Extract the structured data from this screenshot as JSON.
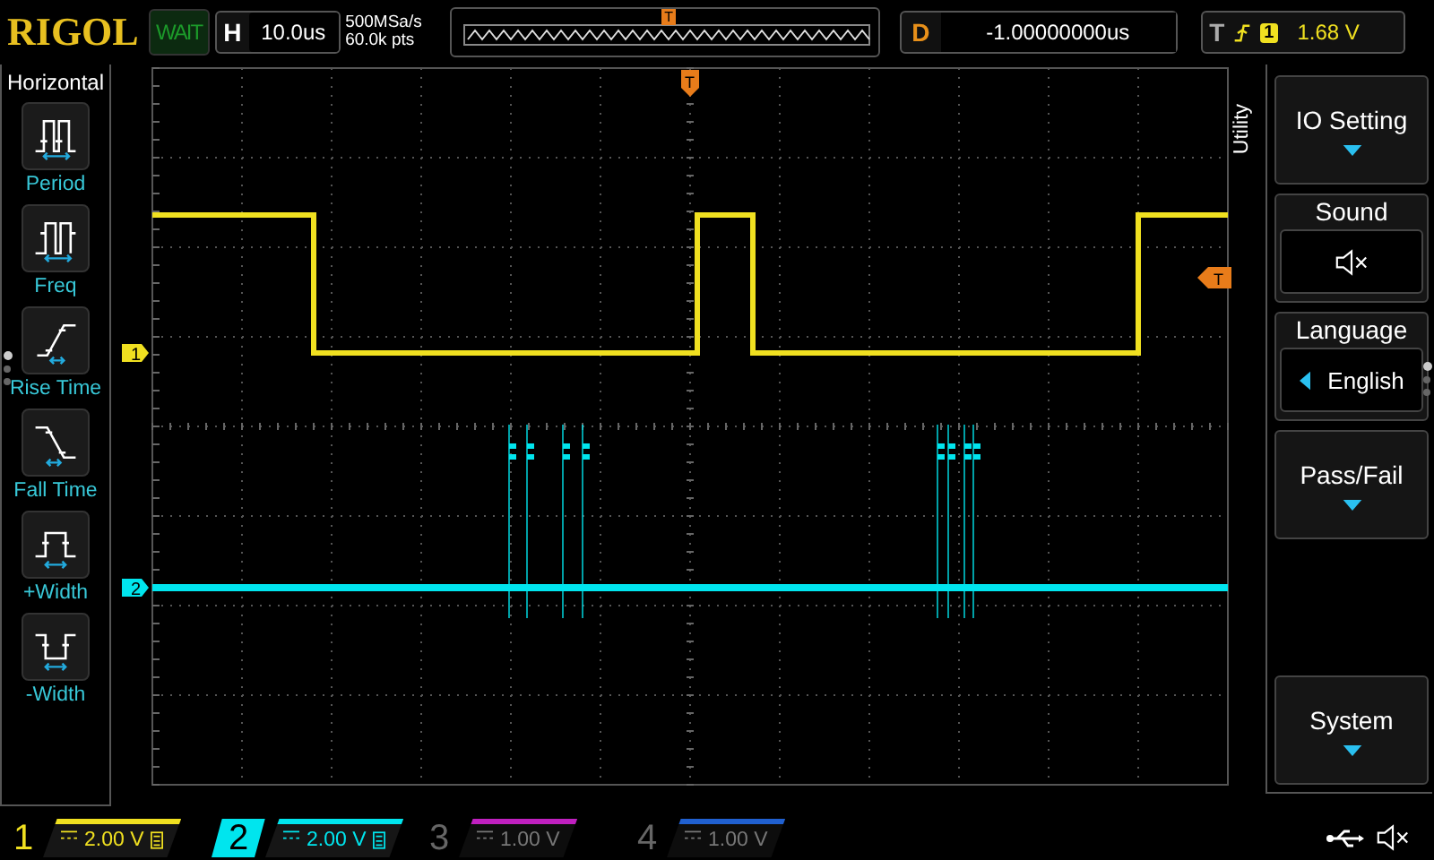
{
  "brand": "RIGOL",
  "run_status": "WAIT",
  "horizontal": {
    "label": "H",
    "value": "10.0us"
  },
  "acquisition": {
    "sample_rate": "500MSa/s",
    "memory_depth": "60.0k pts"
  },
  "timeline": {
    "trigger_marker": "T"
  },
  "delay": {
    "label": "D",
    "value": "-1.00000000us"
  },
  "trigger": {
    "label": "T",
    "source": "1",
    "level": "1.68 V"
  },
  "trace_markers": {
    "trigger_position": "T",
    "trigger_level": "T",
    "channels": [
      "1",
      "2"
    ]
  },
  "left_menu": {
    "title": "Horizontal",
    "items": [
      {
        "kind": "period",
        "label": "Period"
      },
      {
        "kind": "freq",
        "label": "Freq"
      },
      {
        "kind": "rise",
        "label": "Rise Time"
      },
      {
        "kind": "fall",
        "label": "Fall Time"
      },
      {
        "kind": "pos_width",
        "label": "+Width"
      },
      {
        "kind": "neg_width",
        "label": "-Width"
      }
    ],
    "pages": [
      {
        "selected": true
      },
      {
        "selected": false
      },
      {
        "selected": false
      }
    ]
  },
  "right_menu": {
    "title": "Utility",
    "items": [
      {
        "kind": "submenu",
        "label": "IO Setting"
      },
      {
        "kind": "mute",
        "label": "Sound",
        "on": false
      },
      {
        "kind": "option",
        "label": "Language",
        "value": "English"
      },
      {
        "kind": "submenu",
        "label": "Pass/Fail"
      },
      {
        "kind": "submenu",
        "label": "System"
      }
    ],
    "pages": [
      {
        "selected": true
      },
      {
        "selected": false
      },
      {
        "selected": false
      }
    ]
  },
  "channels": [
    {
      "label": "1",
      "scale": "2.00 V",
      "color": "#f0e020",
      "enabled": true,
      "selected": false
    },
    {
      "label": "2",
      "scale": "2.00 V",
      "color": "#00e5ee",
      "enabled": true,
      "selected": true
    },
    {
      "label": "3",
      "scale": "1.00 V",
      "color": "#c020c0",
      "enabled": false,
      "selected": false
    },
    {
      "label": "4",
      "scale": "1.00 V",
      "color": "#2060d0",
      "enabled": false,
      "selected": false
    }
  ]
}
